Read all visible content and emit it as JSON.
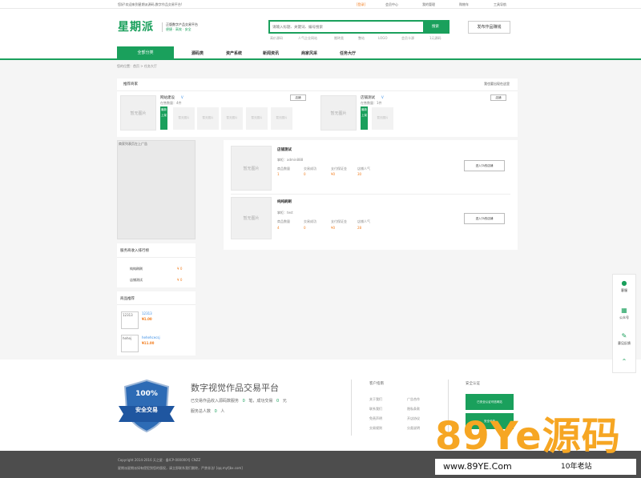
{
  "topbar": {
    "welcome": "您好!欢迎来到星期派源码,数字作品交易平台!",
    "login": "[登录]",
    "register": "会员中心",
    "my_orders": "我的管理",
    "buyer": "购物车",
    "service": "工具导航"
  },
  "header": {
    "logo": "星期派",
    "slogan_line1": "正版数字产品交易平台",
    "slogan_tags": "便捷 · 高效 · 安全",
    "search_placeholder": "请输入标题、关键词、编号搜索",
    "search_button": "搜索",
    "hot_words": [
      "高价源码",
      "人气企业网站",
      "搬砖类",
      "整站",
      "LOGO",
      "会员卡源",
      "1元源码"
    ],
    "publish_button": "发布作品赚钱"
  },
  "nav": {
    "category": "全部分类",
    "items": [
      "源码类",
      "资产系统",
      "新闻资讯",
      "商家风采",
      "任务大厅"
    ]
  },
  "breadcrumb": "您的位置：首页 > 任务大厅",
  "recommend": {
    "title": "推荐商家",
    "more": "我也要出现在这里",
    "image_placeholder": "暂无图片",
    "shops": [
      {
        "name": "网站建设",
        "badge": "V",
        "count_label": "在售数量：4件",
        "button": "店铺",
        "ribbon": "最新上架",
        "thumbs": [
          "暂无图片",
          "暂无图片",
          "暂无图片",
          "暂无图片",
          "暂无图片"
        ]
      },
      {
        "name": "店铺测试",
        "badge": "V",
        "count_label": "在售数量：1件",
        "button": "店铺",
        "ribbon": "最新上架",
        "thumbs": [
          "暂无图片"
        ]
      }
    ]
  },
  "ad_left": "商家列表页左上广告",
  "shop_list": [
    {
      "name": "店铺测试",
      "owner": "掌柜：admin888",
      "stats_labels": [
        "商品数量",
        "交易成功",
        "支付保证金",
        "店铺人气"
      ],
      "stats_values": [
        "1",
        "0",
        "¥0",
        "30"
      ],
      "button": "进入TA的店铺"
    },
    {
      "name": "纯纯刷刷",
      "owner": "掌柜：test",
      "stats_labels": [
        "商品数量",
        "交易成功",
        "支付保证金",
        "店铺人气"
      ],
      "stats_values": [
        "4",
        "0",
        "¥0",
        "28"
      ],
      "button": "进入TA的店铺"
    }
  ],
  "ranking": {
    "title": "服务商收入排行榜",
    "rows": [
      {
        "name": "纯纯刷刷",
        "value": "¥ 0"
      },
      {
        "name": "店铺测试",
        "value": "¥ 0"
      }
    ]
  },
  "goods_rank": {
    "title": "商品推荐",
    "items": [
      {
        "name": "12313",
        "thumb": "12313",
        "price": "¥1.00"
      },
      {
        "name": "hehehcecsj",
        "thumb": "hehej",
        "price": "¥11.00"
      }
    ]
  },
  "footer": {
    "big_title": "数字视觉作品交易平台",
    "stats_line1_pre": "已交易作品收入源码数服务",
    "stats_line1_num1": "0",
    "stats_line1_mid": "笔，成功交易",
    "stats_line1_num2": "0",
    "stats_line1_unit": "元",
    "stats_line2_pre": "服务总人数",
    "stats_line2_num": "0",
    "stats_line2_unit": "人",
    "badge_top": "100%",
    "badge_mid": "安全交易",
    "guide_title": "客户指南",
    "guide_col1": [
      "关于我们",
      "联系我们",
      "免责声明",
      "交易规则"
    ],
    "guide_col2": [
      "广告合作",
      "隐私条款",
      "开店协议",
      "分类说明"
    ],
    "safe_title": "安全认证",
    "safe_badges": [
      "已安全认证可信网站",
      "安全可信"
    ]
  },
  "footer_bottom": {
    "copyright": "Copyright 2014-2016 天之星 · 备ICP-000000号 CNZZ",
    "line2": "星期派星期派如有侵犯到您的版权，请立即联系我们删除，严禁非法! [qq.myfjbx.com]"
  },
  "side_tools": [
    {
      "icon": "chat-icon",
      "label": "客服"
    },
    {
      "icon": "qr-icon",
      "label": "公众号"
    },
    {
      "icon": "edit-icon",
      "label": "意见反馈"
    },
    {
      "icon": "chevron-up-icon",
      "label": ""
    }
  ],
  "watermark": {
    "main": "89Ye源码",
    "url": "www.89YE.Com",
    "tag": "10年老站"
  }
}
